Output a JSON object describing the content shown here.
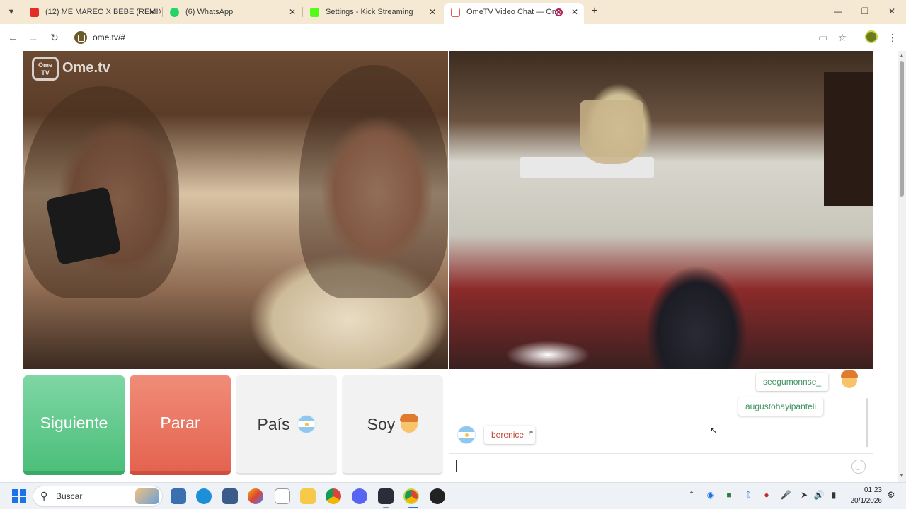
{
  "browser": {
    "tabs": [
      {
        "title": "(12) ME MAREO X BEBE (REMIX",
        "icon": "youtube-icon"
      },
      {
        "title": "(6) WhatsApp",
        "icon": "whatsapp-icon"
      },
      {
        "title": "Settings - Kick Streaming",
        "icon": "kick-icon"
      },
      {
        "title": "OmeTV Video Chat — Ome",
        "icon": "ometv-icon"
      }
    ],
    "url": "ome.tv/#"
  },
  "logo": {
    "badge": "Ome TV",
    "text": "Ome.tv"
  },
  "controls": {
    "next": "Siguiente",
    "stop": "Parar",
    "country": "País",
    "soy": "Soy"
  },
  "chat": {
    "messages": [
      {
        "text": "seegumonnse_",
        "side": "mine"
      },
      {
        "text": "augustohayipanteli",
        "side": "mine"
      },
      {
        "text": "berenice",
        "side": "theirs"
      }
    ],
    "input_value": ""
  },
  "taskbar": {
    "search_placeholder": "Buscar",
    "time": "01:23",
    "date": "20/1/2026"
  },
  "colors": {
    "next_button": "#4cbf7a",
    "stop_button": "#e46350",
    "tab_bar": "#f6e9d4"
  }
}
